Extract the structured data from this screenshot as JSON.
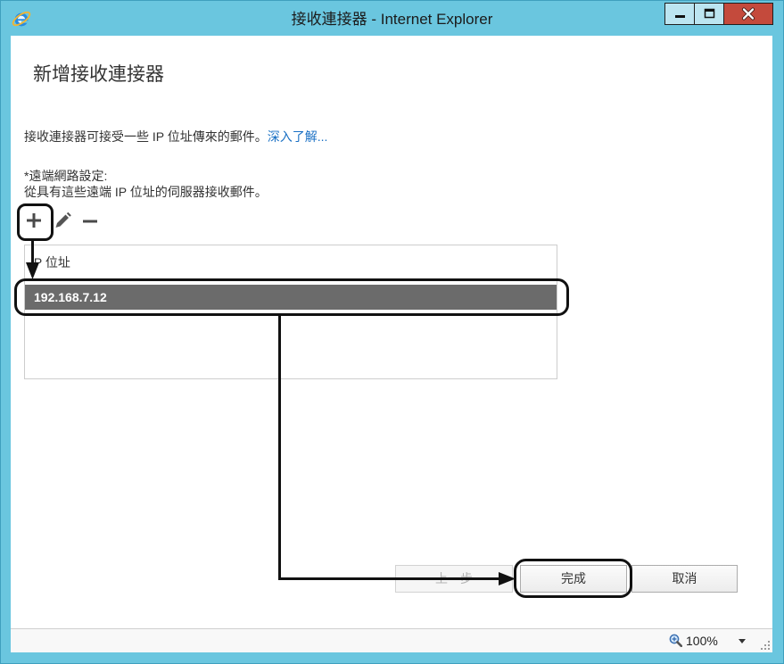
{
  "window": {
    "title": "接收連接器 - Internet Explorer",
    "app_icon": "internet-explorer-icon",
    "controls": {
      "minimize_icon": "minimize-icon",
      "maximize_icon": "maximize-icon",
      "close_icon": "close-icon"
    }
  },
  "page": {
    "heading": "新增接收連接器",
    "description": "接收連接器可接受一些 IP 位址傳來的郵件。",
    "learn_more_link": "深入了解...",
    "remote_network": {
      "label": "*遠端網路設定:",
      "hint": "從具有這些遠端 IP 位址的伺服器接收郵件。"
    },
    "toolbar": {
      "add_icon": "plus-icon",
      "edit_icon": "pencil-icon",
      "remove_icon": "minus-icon"
    },
    "ip_table": {
      "columns": [
        "IP 位址"
      ],
      "rows": [
        {
          "ip": "192.168.7.12",
          "selected": true
        }
      ]
    },
    "buttons": {
      "back": "上一步",
      "finish": "完成",
      "cancel": "取消"
    }
  },
  "status_bar": {
    "zoom_icon": "zoom-icon",
    "zoom_level": "100%",
    "zoom_menu_icon": "chevron-down-icon",
    "resize_icon": "resize-grip-icon"
  },
  "colors": {
    "frame": "#6ac6df",
    "close_button": "#c44a3c",
    "link": "#1a70c4",
    "selected_row": "#6b6b6b",
    "selected_row_text": "#ffffff",
    "annotation": "#111111"
  }
}
